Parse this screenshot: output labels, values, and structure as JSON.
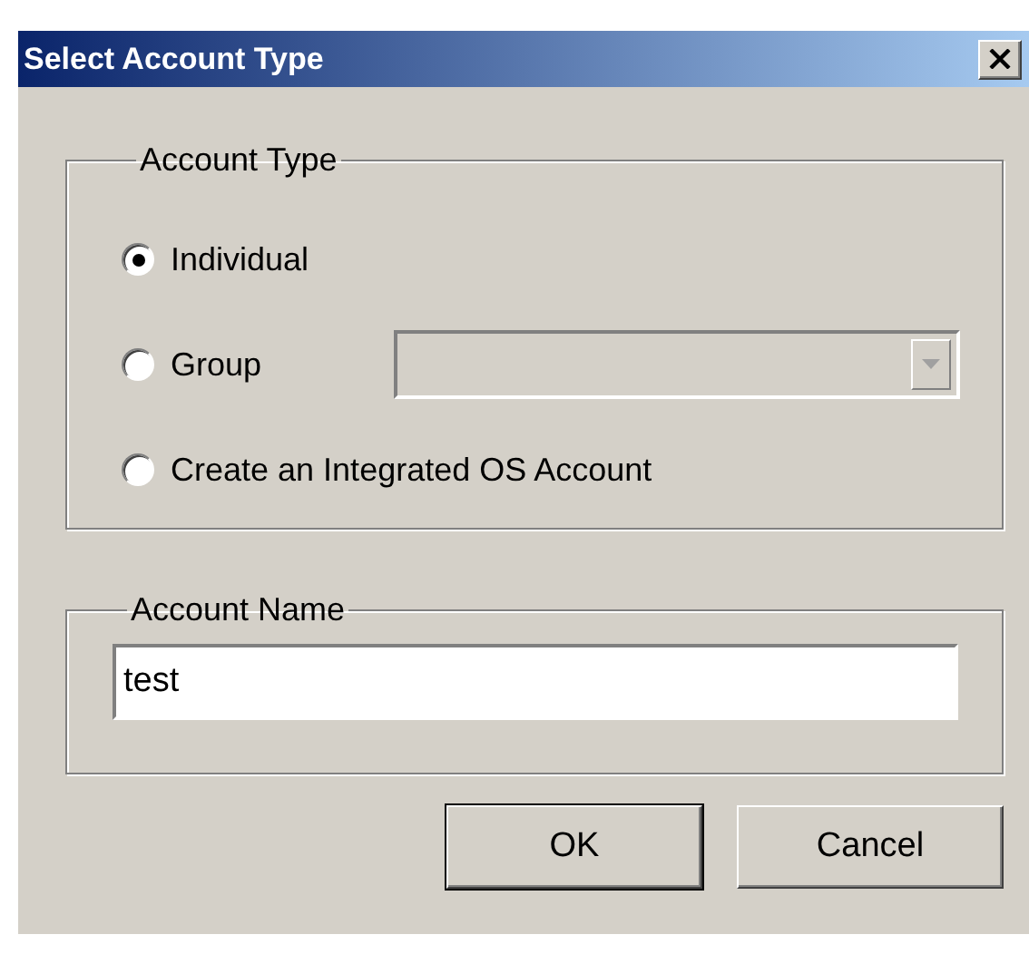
{
  "window": {
    "title": "Select Account Type"
  },
  "account_type": {
    "label": "Account Type",
    "options": [
      {
        "label": "Individual",
        "selected": true
      },
      {
        "label": "Group",
        "selected": false,
        "dropdown": {
          "disabled": true
        }
      },
      {
        "label": "Create an Integrated OS Account",
        "selected": false
      }
    ]
  },
  "account_name": {
    "label": "Account Name",
    "value": "test"
  },
  "buttons": [
    {
      "label": "OK",
      "default": true
    },
    {
      "label": "Cancel",
      "default": false
    }
  ]
}
